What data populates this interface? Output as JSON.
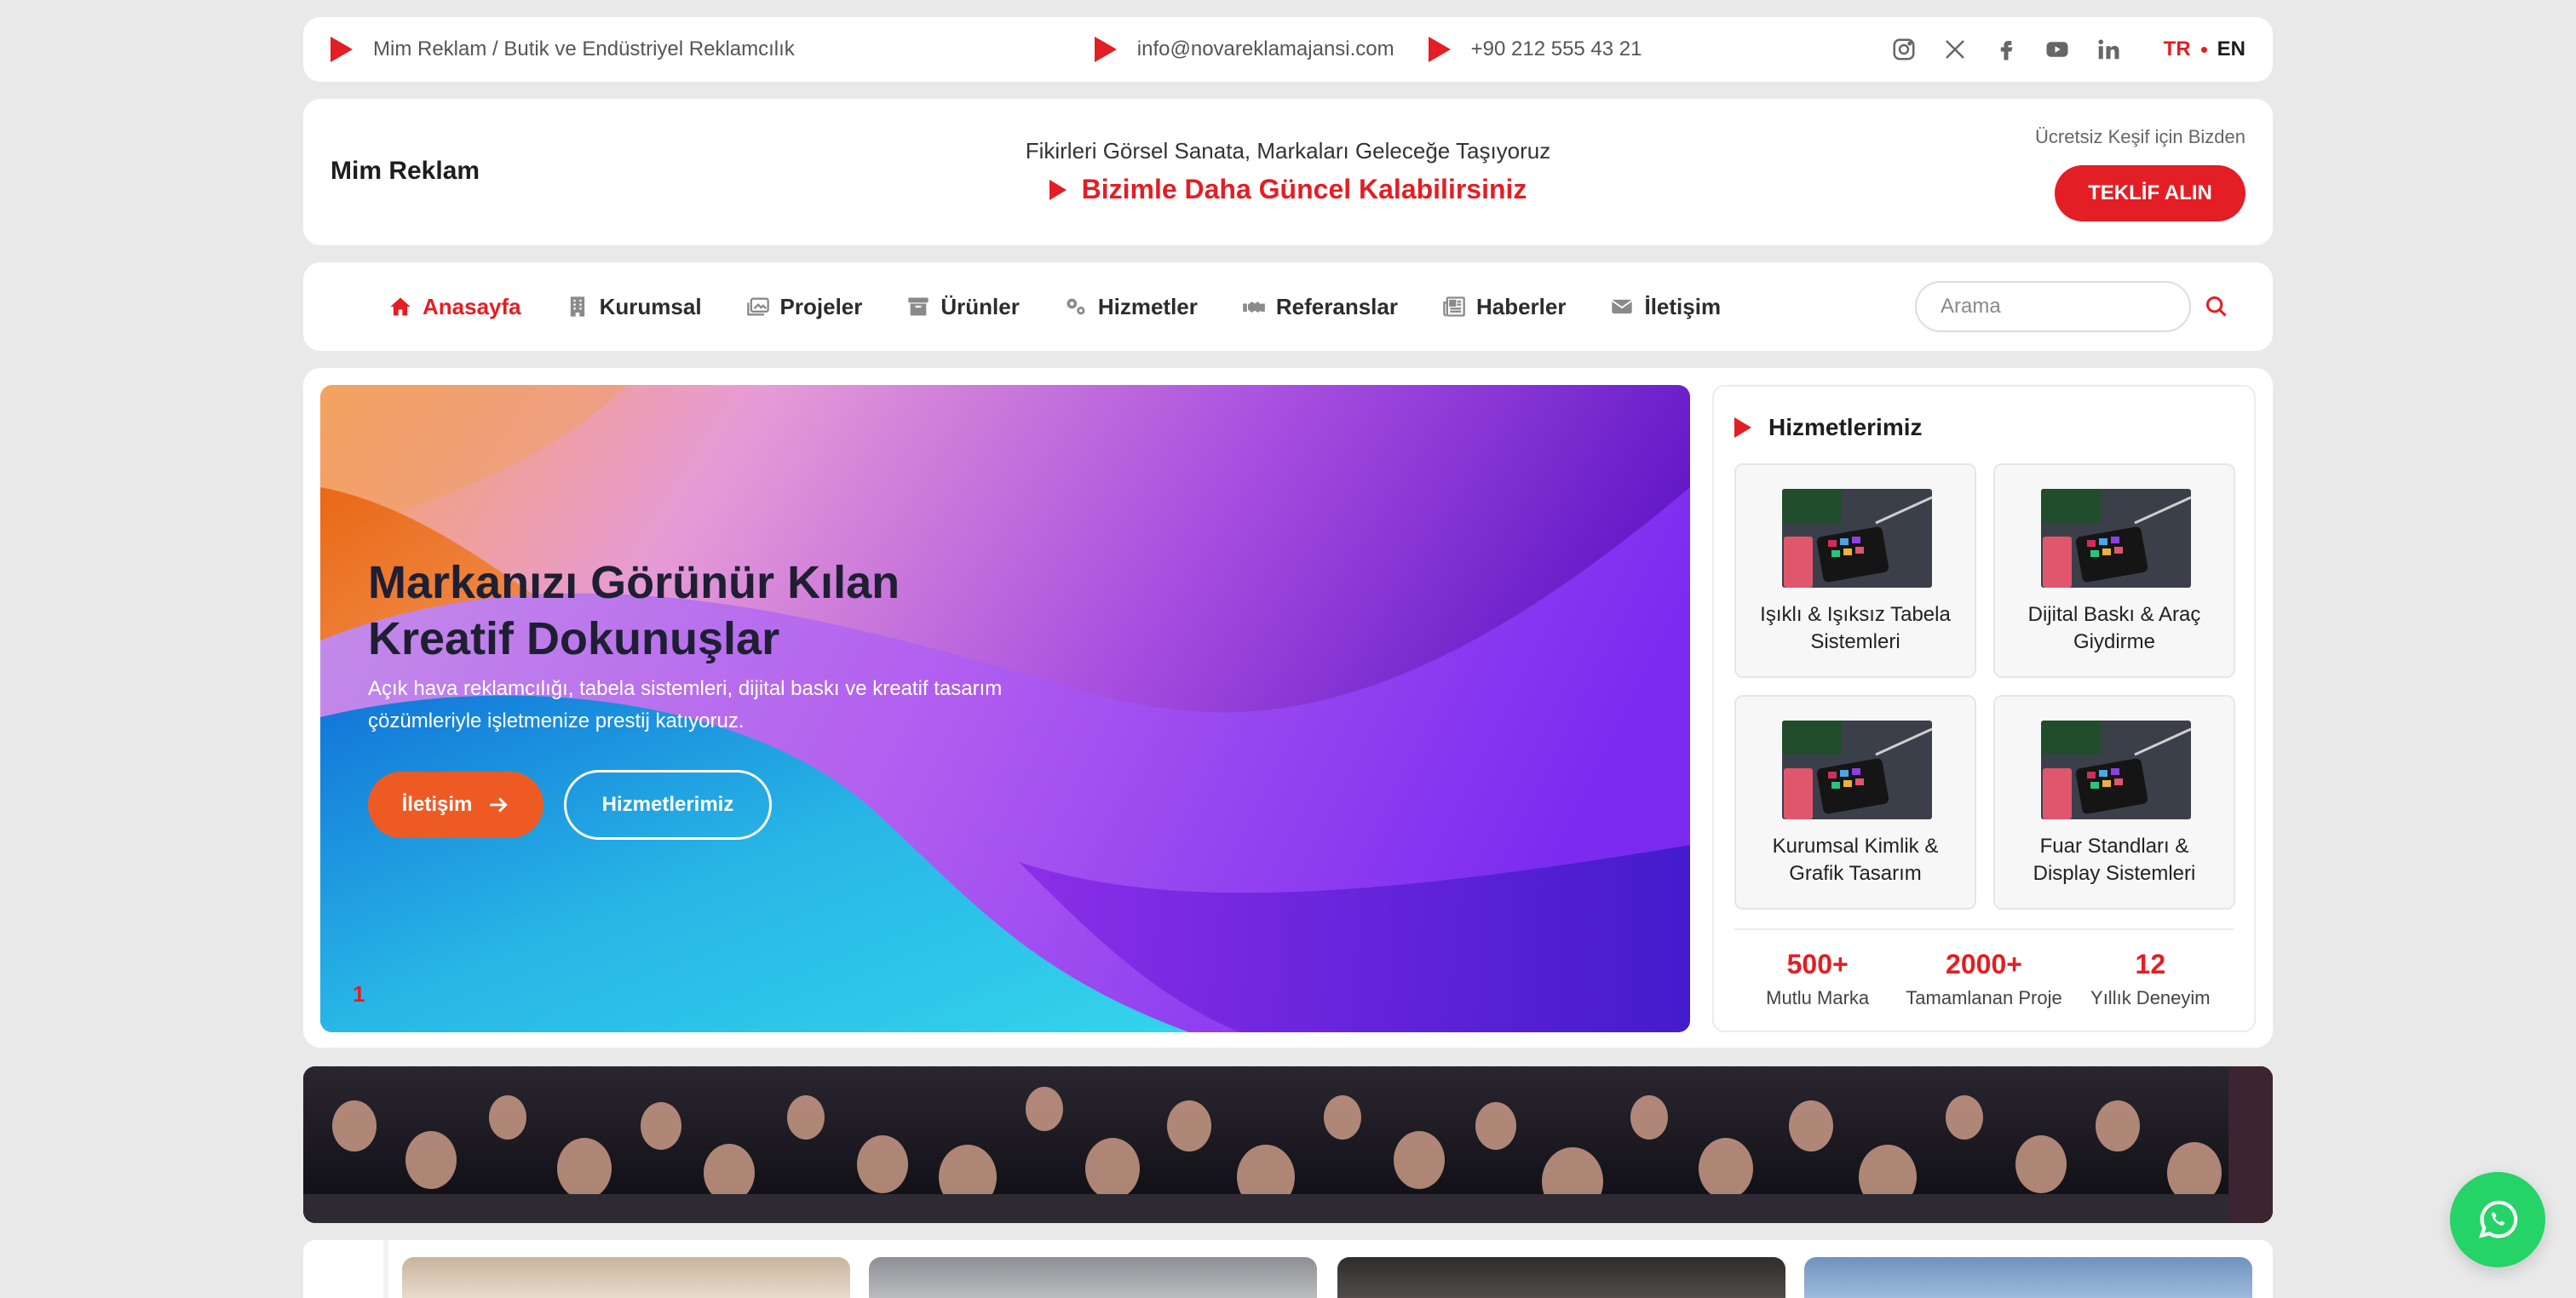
{
  "topbar": {
    "company": "Mim Reklam / Butik ve Endüstriyel Reklamcılık",
    "email": "info@novareklamajansi.com",
    "phone": "+90 212 555 43 21",
    "social": [
      "instagram-icon",
      "x-icon",
      "facebook-icon",
      "youtube-icon",
      "linkedin-icon"
    ],
    "lang_tr": "TR",
    "lang_en": "EN"
  },
  "header": {
    "brand": "Mim Reklam",
    "tagline": "Fikirleri Görsel Sanata, Markaları Geleceğe Taşıyoruz",
    "slogan": "Bizimle Daha Güncel Kalabilirsiniz",
    "offer_note": "Ücretsiz Keşif için Bizden",
    "offer_button": "TEKLİF ALIN"
  },
  "nav": {
    "items": [
      {
        "label": "Anasayfa",
        "icon": "home-icon"
      },
      {
        "label": "Kurumsal",
        "icon": "building-icon"
      },
      {
        "label": "Projeler",
        "icon": "images-icon"
      },
      {
        "label": "Ürünler",
        "icon": "box-icon"
      },
      {
        "label": "Hizmetler",
        "icon": "gears-icon"
      },
      {
        "label": "Referanslar",
        "icon": "handshake-icon"
      },
      {
        "label": "Haberler",
        "icon": "newspaper-icon"
      },
      {
        "label": "İletişim",
        "icon": "envelope-icon"
      }
    ],
    "search_placeholder": "Arama"
  },
  "hero": {
    "title": "Markanızı Görünür Kılan Kreatif Dokunuşlar",
    "subtitle": "Açık hava reklamcılığı, tabela sistemleri, dijital baskı ve kreatif tasarım çözümleriyle işletmenize prestij katıyoruz.",
    "button_primary": "İletişim",
    "button_secondary": "Hizmetlerimiz",
    "slide_index": "1"
  },
  "services": {
    "heading": "Hizmetlerimiz",
    "items": [
      {
        "label": "Işıklı & Işıksız Tabela Sistemleri"
      },
      {
        "label": "Dijital Baskı & Araç Giydirme"
      },
      {
        "label": "Kurumsal Kimlik & Grafik Tasarım"
      },
      {
        "label": "Fuar Standları & Display Sistemleri"
      }
    ],
    "stats": [
      {
        "value": "500+",
        "label": "Mutlu Marka"
      },
      {
        "value": "2000+",
        "label": "Tamamlanan Proje"
      },
      {
        "value": "12",
        "label": "Yıllık Deneyim"
      }
    ]
  },
  "colors": {
    "accent": "#e31e24",
    "hero_button": "#ee5a24",
    "whatsapp": "#25d366"
  }
}
